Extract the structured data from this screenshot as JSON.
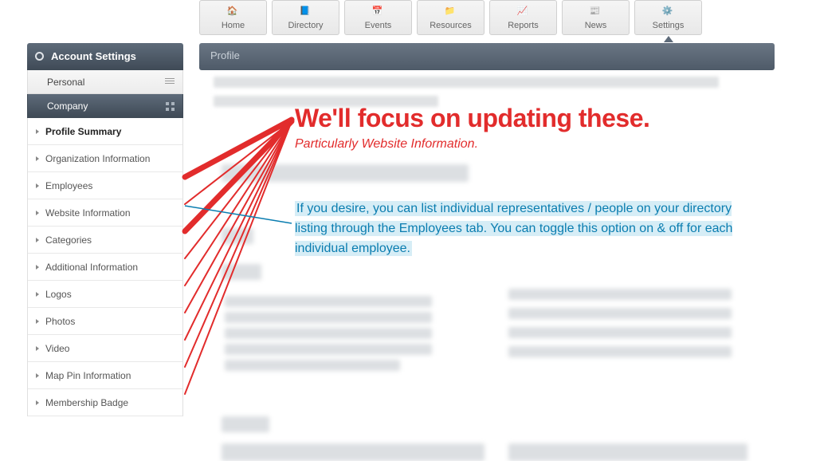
{
  "topnav": [
    {
      "label": "Home",
      "name": "nav-home"
    },
    {
      "label": "Directory",
      "name": "nav-directory"
    },
    {
      "label": "Events",
      "name": "nav-events"
    },
    {
      "label": "Resources",
      "name": "nav-resources"
    },
    {
      "label": "Reports",
      "name": "nav-reports"
    },
    {
      "label": "News",
      "name": "nav-news"
    },
    {
      "label": "Settings",
      "name": "nav-settings",
      "active": true
    }
  ],
  "profile_bar": "Profile",
  "sidebar": {
    "title": "Account Settings",
    "personal": "Personal",
    "company": "Company",
    "items": [
      {
        "label": "Profile Summary",
        "bold": true
      },
      {
        "label": "Organization Information"
      },
      {
        "label": "Employees"
      },
      {
        "label": "Website Information"
      },
      {
        "label": "Categories"
      },
      {
        "label": "Additional Information"
      },
      {
        "label": "Logos"
      },
      {
        "label": "Photos"
      },
      {
        "label": "Video"
      },
      {
        "label": "Map Pin Information"
      },
      {
        "label": "Membership Badge"
      }
    ]
  },
  "annotations": {
    "title": "We'll focus on updating these.",
    "subtitle": "Particularly Website Information.",
    "blue": "If you desire, you can list individual representatives / people on your directory listing through the Employees tab. You can toggle this option on & off for each individual employee."
  }
}
